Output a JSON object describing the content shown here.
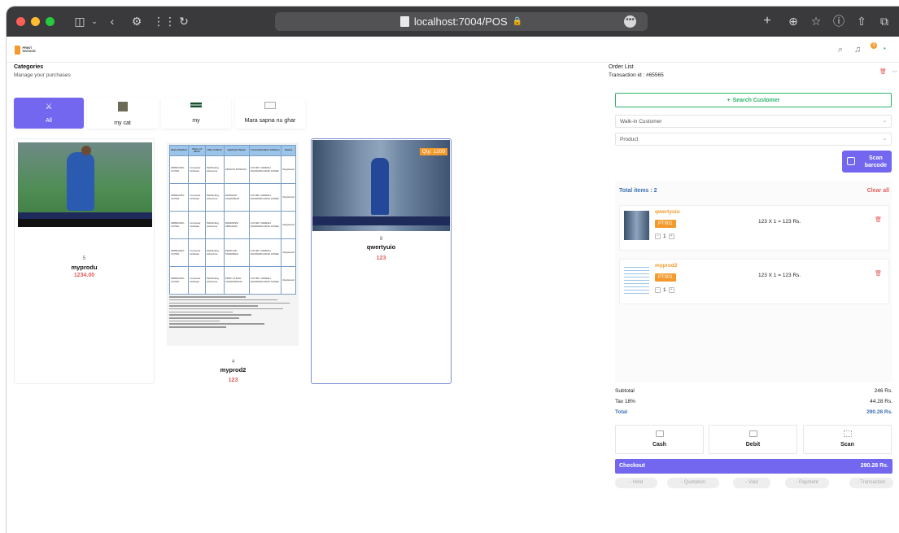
{
  "browser": {
    "url": "localhost:7004/POS",
    "lock_icon": "lock-icon",
    "toolbar_icons": [
      "sidebar-icon",
      "chevron-down-icon",
      "back-icon",
      "settings-icon",
      "grid-icon",
      "reload-icon",
      "plus-icon",
      "download-icon",
      "star-icon",
      "info-icon",
      "share-icon",
      "tabs-icon"
    ]
  },
  "header": {
    "logo_text": "PRINT INVOICE",
    "notification_count": "3",
    "brand_color": "#f39a2b"
  },
  "categories": {
    "title": "Categories",
    "subtitle": "Manage your purchases",
    "items": [
      {
        "label": "All",
        "active": true
      },
      {
        "label": "my cat",
        "active": false
      },
      {
        "label": "my",
        "active": false
      },
      {
        "label": "Mara sapna nu ghar",
        "active": false
      }
    ]
  },
  "products": [
    {
      "count": "5",
      "name": "myprodu",
      "price": "1234.00",
      "selected": false
    },
    {
      "count": "4",
      "name": "myprod2",
      "price": "123",
      "selected": false
    },
    {
      "count": "8",
      "name": "qwertyuio",
      "price": "123",
      "selected": true,
      "qty_badge": "Qty: 1200"
    }
  ],
  "document_thumb": {
    "headers": [
      "Diary Number",
      "Class of Work",
      "Title of Work",
      "Applicant Name",
      "Communication Address",
      "Status"
    ],
    "rows": [
      [
        "30890/2023-CO/SW",
        "Computer Software",
        "Pathfinding Adventure",
        "ADVAIYA ROSHAN",
        "C/O MR. NARESH DILAWARCHAND JAISEA",
        "Registered"
      ],
      [
        "30890/2023-CO/SW",
        "Computer Software",
        "Pathfinding Adventure",
        "DARSHAN ASHOKBHAI",
        "C/O MR. NARESH DILAWARCHAND JAISEA",
        "Registered"
      ],
      [
        "30890/2023-CO/SW",
        "Computer Software",
        "Pathfinding Adventure",
        "PARIMANSI ABRAHAM",
        "C/O MR. NARESH DILAWARCHAND JAISEA",
        "Registered"
      ],
      [
        "30890/2023-CO/SW",
        "Computer Software",
        "Pathfinding Adventure",
        "PRATHVIK SUDHIBHAI",
        "C/O MR. NARESH DILAWARCHAND JAISEA",
        "Registered"
      ],
      [
        "30890/2023-CO/SW",
        "Computer Software",
        "Pathfinding Adventure",
        "PROF. PURAV CHANDARANA",
        "C/O MR. NARESH DILAWARCHAND JAISEA",
        "Registered"
      ]
    ]
  },
  "order": {
    "title": "Order List",
    "transaction_label": "Transaction id : #65565",
    "search_customer": "Search Customer",
    "customer_select": "Walk-in Customer",
    "product_select": "Product",
    "scan_label_1": "Scan",
    "scan_label_2": "barcode",
    "total_items": "Total items : 2",
    "clear_all": "Clear all",
    "items": [
      {
        "name": "qwertyuio",
        "code": "PT001",
        "qty": "1",
        "line": "123 X 1 = 123 Rs."
      },
      {
        "name": "myprod2",
        "code": "PT001",
        "qty": "1",
        "line": "123 X 1 = 123 Rs."
      }
    ]
  },
  "summary": {
    "subtotal_label": "Subtotal",
    "subtotal": "246 Rs.",
    "tax_label": "Tax 18%",
    "tax": "44.28 Rs.",
    "total_label": "Total",
    "total": "290.28 Rs."
  },
  "payment": {
    "methods": [
      "Cash",
      "Debit",
      "Scan"
    ],
    "checkout_label": "Checkout",
    "checkout_amount": "290.28 Rs.",
    "actions": [
      "Hold",
      "Quotation",
      "Void",
      "Payment",
      "Transaction"
    ],
    "accent_color": "#7367f0"
  }
}
